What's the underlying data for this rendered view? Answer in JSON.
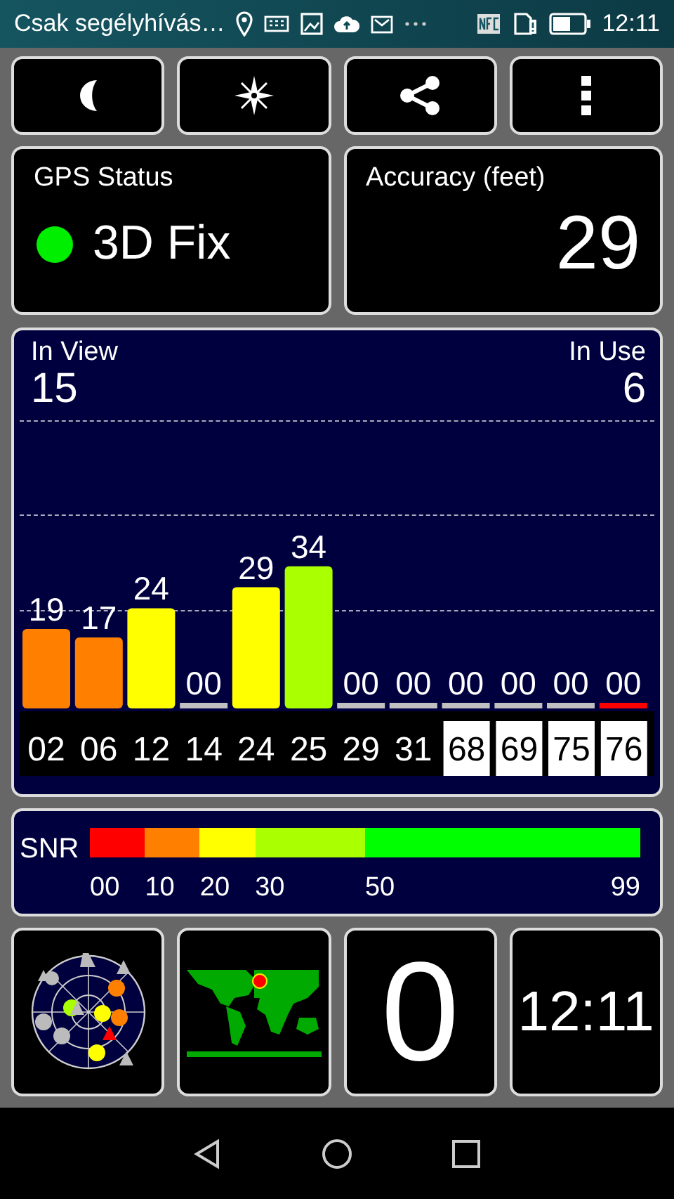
{
  "status_bar": {
    "carrier": "Csak segélyhívás…",
    "time": "12:11"
  },
  "toolbar": [
    {
      "kind": "night"
    },
    {
      "kind": "compass"
    },
    {
      "kind": "share"
    },
    {
      "kind": "menu"
    }
  ],
  "gps_status": {
    "title": "GPS Status",
    "value": "3D Fix",
    "color": "#00ee00"
  },
  "accuracy": {
    "title": "Accuracy (feet)",
    "value": "29"
  },
  "satellites": {
    "in_view_label": "In View",
    "in_view": "15",
    "in_use_label": "In Use",
    "in_use": "6",
    "chart_data": {
      "type": "bar",
      "categories": [
        "02",
        "06",
        "12",
        "14",
        "24",
        "25",
        "29",
        "31",
        "68",
        "69",
        "75",
        "76"
      ],
      "values": [
        19,
        17,
        24,
        0,
        29,
        34,
        0,
        0,
        0,
        0,
        0,
        0
      ],
      "value_labels": [
        "19",
        "17",
        "24",
        "00",
        "29",
        "34",
        "00",
        "00",
        "00",
        "00",
        "00",
        "00"
      ]
    },
    "bars": [
      {
        "kind": "plain",
        "color": "#ff8000"
      },
      {
        "kind": "plain",
        "color": "#ff8000"
      },
      {
        "kind": "plain",
        "color": "#ffff00"
      },
      {
        "kind": "plain",
        "color": "#c0c0c0"
      },
      {
        "kind": "plain",
        "color": "#ffff00"
      },
      {
        "kind": "plain",
        "color": "#aaff00"
      },
      {
        "kind": "plain",
        "color": "#c0c0c0"
      },
      {
        "kind": "plain",
        "color": "#c0c0c0"
      },
      {
        "kind": "boxed",
        "color": "#c0c0c0"
      },
      {
        "kind": "boxed",
        "color": "#c0c0c0"
      },
      {
        "kind": "boxed",
        "color": "#c0c0c0"
      },
      {
        "kind": "boxed",
        "color": "#ff0000"
      }
    ]
  },
  "snr_legend": {
    "label": "SNR",
    "segments": [
      {
        "label": "00",
        "color": "#ff0000"
      },
      {
        "label": "10",
        "color": "#ff8000"
      },
      {
        "label": "20",
        "color": "#ffff00"
      },
      {
        "label": "30",
        "color": "#aaff00"
      },
      {
        "label": "50",
        "color": "#00ff00"
      }
    ],
    "end_label": "99"
  },
  "tiles": [
    {
      "kind": "sky"
    },
    {
      "kind": "map"
    },
    {
      "kind": "text",
      "value": "0"
    },
    {
      "kind": "text",
      "value": "12:11"
    }
  ],
  "nav_bar": [
    {
      "kind": "back"
    },
    {
      "kind": "home"
    },
    {
      "kind": "recents"
    }
  ]
}
